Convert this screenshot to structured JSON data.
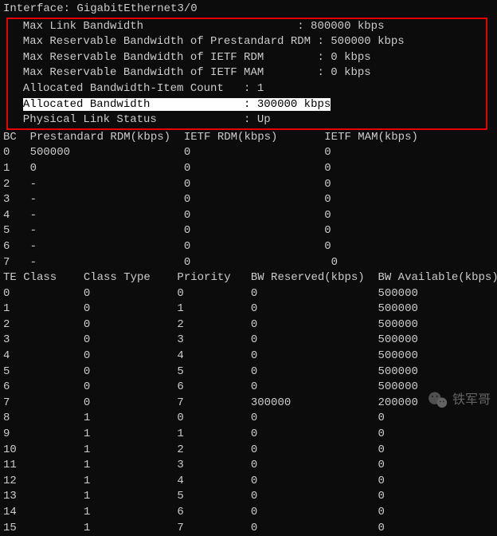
{
  "interface_label": "Interface: ",
  "interface_name": "GigabitEthernet3/0",
  "boxed": {
    "max_link_bw": "  Max Link Bandwidth                       : 800000 kbps",
    "max_res_prestd": "  Max Reservable Bandwidth of Prestandard RDM : 500000 kbps",
    "max_res_ietf_rdm": "  Max Reservable Bandwidth of IETF RDM        : 0 kbps",
    "max_res_ietf_mam": "  Max Reservable Bandwidth of IETF MAM        : 0 kbps",
    "alloc_item_count": "  Allocated Bandwidth-Item Count   : 1",
    "alloc_bw_prefix": "  ",
    "alloc_bw_hl": "Allocated Bandwidth              : 300000 kbps",
    "phys_link": "  Physical Link Status             : Up"
  },
  "bc_header": "BC  Prestandard RDM(kbps)  IETF RDM(kbps)       IETF MAM(kbps)",
  "bc_rows": [
    "0   500000                 0                    0",
    "1   0                      0                    0",
    "2   -                      0                    0",
    "3   -                      0                    0",
    "4   -                      0                    0",
    "5   -                      0                    0",
    "6   -                      0                    0",
    "7   -                      0                     0"
  ],
  "te_header": "TE Class    Class Type    Priority   BW Reserved(kbps)  BW Available(kbps)",
  "te_rows": [
    "0           0             0          0                  500000",
    "1           0             1          0                  500000",
    "2           0             2          0                  500000",
    "3           0             3          0                  500000",
    "4           0             4          0                  500000",
    "5           0             5          0                  500000",
    "6           0             6          0                  500000",
    "7           0             7          300000             200000",
    "8           1             0          0                  0",
    "9           1             1          0                  0",
    "10          1             2          0                  0",
    "11          1             3          0                  0",
    "12          1             4          0                  0",
    "13          1             5          0                  0",
    "14          1             6          0                  0",
    "15          1             7          0                  0"
  ],
  "watermark": "铁军哥"
}
